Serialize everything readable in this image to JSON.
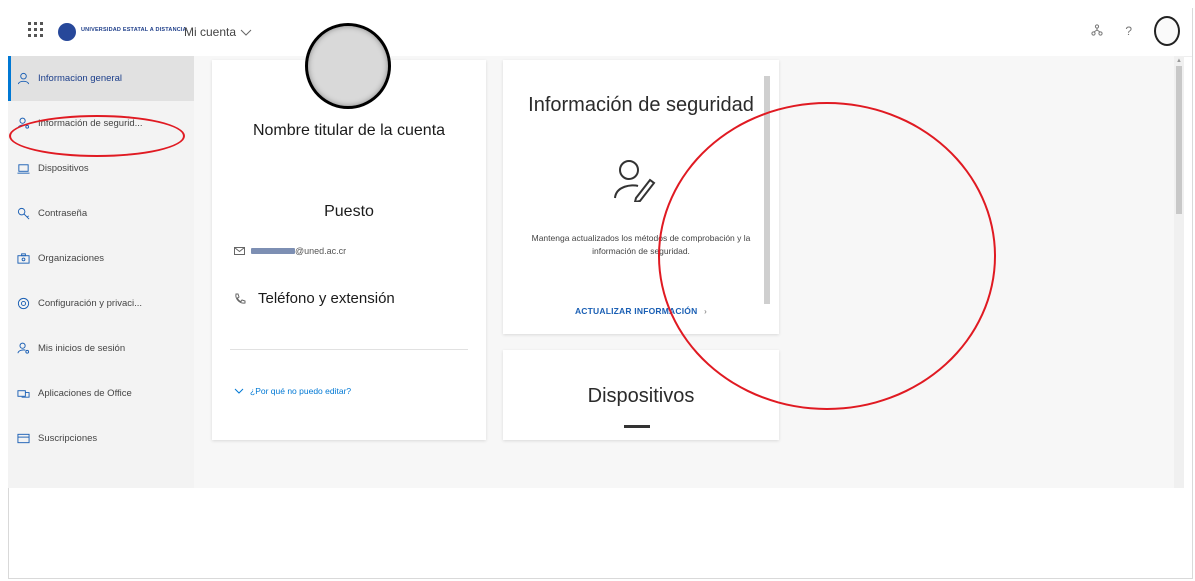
{
  "topbar": {
    "logo": {
      "line1": "UNIVERSIDAD ESTATAL A DISTANCIA",
      "line2": ""
    },
    "account_menu_label": "Mi cuenta",
    "help_label": "?"
  },
  "sidebar": {
    "items": [
      {
        "label": "Informacion general",
        "icon": "person-icon",
        "active": true
      },
      {
        "label": "Información de segurid...",
        "icon": "person-key-icon",
        "active": false
      },
      {
        "label": "Dispositivos",
        "icon": "laptop-icon",
        "active": false
      },
      {
        "label": "Contraseña",
        "icon": "key-icon",
        "active": false
      },
      {
        "label": "Organizaciones",
        "icon": "briefcase-icon",
        "active": false
      },
      {
        "label": "Configuración y privaci...",
        "icon": "gear-icon",
        "active": false
      },
      {
        "label": "Mis inicios de sesión",
        "icon": "person-key-icon",
        "active": false
      },
      {
        "label": "Aplicaciones de Office",
        "icon": "office-apps-icon",
        "active": false
      },
      {
        "label": "Suscripciones",
        "icon": "card-icon",
        "active": false
      }
    ]
  },
  "profile": {
    "name": "Nombre titular de la cuenta",
    "role": "Puesto",
    "email_domain": "@uned.ac.cr",
    "phone": "Teléfono y extensión",
    "why_cant_edit": "¿Por qué no puedo editar?"
  },
  "security_card": {
    "title": "Información de seguridad",
    "description": "Mantenga actualizados los métodos de comprobación y la información de seguridad.",
    "link_label": "ACTUALIZAR INFORMACIÓN",
    "link_chevron": "›"
  },
  "devices_card": {
    "title": "Dispositivos"
  },
  "colors": {
    "accent": "#0078d4",
    "annotation": "#e01a22",
    "sidebar_bg": "#f3f3f3"
  }
}
